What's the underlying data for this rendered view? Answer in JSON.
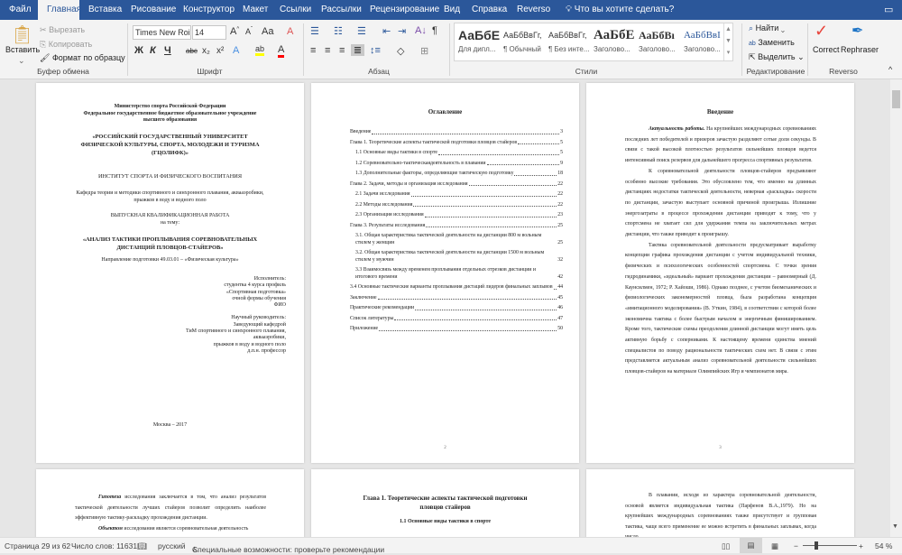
{
  "tabs": [
    "Файл",
    "Главная",
    "Вставка",
    "Рисование",
    "Конструктор",
    "Макет",
    "Ссылки",
    "Рассылки",
    "Рецензирование",
    "Вид",
    "Справка",
    "Reverso"
  ],
  "tell_me": "Что вы хотите сделать?",
  "clipboard": {
    "paste": "Вставить",
    "cut": "Вырезать",
    "copy": "Копировать",
    "format_painter": "Формат по образцу",
    "label": "Буфер обмена"
  },
  "font": {
    "name": "Times New Roi",
    "size": "14",
    "label": "Шрифт",
    "bold": "Ж",
    "italic": "К",
    "underline": "Ч"
  },
  "paragraph": {
    "label": "Абзац"
  },
  "styles": {
    "label": "Стили",
    "items": [
      {
        "preview": "АаБбЕ",
        "name": "Для дипл..."
      },
      {
        "preview": "АаБбВвГг,",
        "name": "¶ Обычный"
      },
      {
        "preview": "АаБбВвГг,",
        "name": "¶ Без инте..."
      },
      {
        "preview": "АаБбЕ",
        "name": "Заголово..."
      },
      {
        "preview": "АаБбВı",
        "name": "Заголово..."
      },
      {
        "preview": "АаБбВвI",
        "name": "Заголово..."
      }
    ]
  },
  "editing": {
    "find": "Найти",
    "replace": "Заменить",
    "select": "Выделить",
    "label": "Редактирование"
  },
  "reverso": {
    "correct": "Correct",
    "rephraser": "Rephraser",
    "label": "Reverso"
  },
  "colors": {
    "accent": "#2b579a",
    "highlight": "#ffff00",
    "font_color": "#ff0000"
  },
  "page1": {
    "lines_top": [
      "Министерство спорта Российской Федерации",
      "Федеральное государственное бюджетное образовательное учреждение",
      "высшего образования"
    ],
    "university": "«РОССИЙСКИЙ ГОСУДАРСТВЕННЫЙ УНИВЕРСИТЕТ ФИЗИЧЕСКОЙ КУЛЬТУРЫ, СПОРТА, МОЛОДЕЖИ И ТУРИЗМА (ГЦОЛИФК)»",
    "institute": "ИНСТИТУТ СПОРТА И ФИЗИЧЕСКОГО ВОСПИТАНИЯ",
    "department": "Кафедра теории и методики спортивного и синхронного плавания, аквааэробики, прыжков в воду и водного поло",
    "work_type": "ВЫПУСКНАЯ КВАЛИФИКАЦИОННАЯ РАБОТА",
    "on_topic": "на тему:",
    "title": "«АНАЛИЗ ТАКТИКИ ПРОПЛЫВАНИЯ СОРЕВНОВАТЕЛЬНЫХ ДИСТАНЦИЙ ПЛОВЦОВ-СТАЙЕРОВ»",
    "direction": "Направление подготовки 49.03.01 – «Физическая культура»",
    "executor": [
      "Исполнитель:",
      "студентка 4 курса профиль",
      "«Спортивная подготовка»",
      "очной формы обучения",
      "ФИО"
    ],
    "supervisor": [
      "Научный руководитель:",
      "Заведующий кафедрой",
      "ТиМ спортивного и синхронного плавания,",
      "аквааэробики,",
      "прыжков в воду и водного поло",
      "д.п.н. профессор"
    ],
    "city_year": "Москва – 2017"
  },
  "page2": {
    "heading": "Оглавление",
    "page_number": "2",
    "toc": [
      {
        "text": "Введение",
        "page": "3",
        "indent": false
      },
      {
        "text": "Глава 1. Теоретические аспекты тактической подготовки пловцов стайеров",
        "page": "5",
        "indent": false
      },
      {
        "text": "1.1 Основные виды тактики в спорте",
        "page": "5",
        "indent": true
      },
      {
        "text": "1.2 Соревновательно-тактическаядеятельность в плавании",
        "page": "9",
        "indent": true
      },
      {
        "text": "1.3 Дополнительные факторы, определяющие тактическую подготовку",
        "page": "18",
        "indent": true
      },
      {
        "text": "Глава 2. Задачи, методы и организация исследования",
        "page": "22",
        "indent": false
      },
      {
        "text": "2.1 Задачи исследования",
        "page": "22",
        "indent": true
      },
      {
        "text": "2.2 Методы исследования",
        "page": "22",
        "indent": true
      },
      {
        "text": "2.3 Организация исследования",
        "page": "23",
        "indent": true
      },
      {
        "text": "Глава 3. Результаты исследования",
        "page": "25",
        "indent": false
      },
      {
        "text": "3.1. Общая характеристика тактической деятельности на дистанции 800 м вольным стилем у женщин",
        "page": "25",
        "indent": true
      },
      {
        "text": "3.2. Общая характеристика тактической деятельности на дистанции 1500 м вольным стилем у мужчин",
        "page": "32",
        "indent": true
      },
      {
        "text": "3.3  Взаимосвязь между временем проплывания отдельных отрезков дистанции и итогового времени",
        "page": "42",
        "indent": true
      },
      {
        "text": "3.4     Основные тактические варианты проплывания дистаций лидеров финальных заплывов",
        "page": "44",
        "indent": false
      },
      {
        "text": "Заключение",
        "page": "45",
        "indent": false
      },
      {
        "text": "Практические рекомендации",
        "page": "46",
        "indent": false
      },
      {
        "text": "Список литературы",
        "page": "47",
        "indent": false
      },
      {
        "text": "Приложение",
        "page": "50",
        "indent": false
      }
    ]
  },
  "page3": {
    "heading": "Введение",
    "page_number": "3",
    "p1_lead": "Актуальность работы.",
    "p1": " На крупнейших международных соревнованиях последних лет победителей и призеров зачастую разделяют сотые доли секунды. В связи с такой высокой плотностью результатов сильнейших пловцов ведется интенсивный поиск резервов для дальнейшего прогресса спортивных результатов.",
    "p2": "К соревновательной деятельности пловцов-стайеров предъявляют особенно высокие требования. Это обусловлено тем, что именно на длинных дистанциях недостатки тактической деятельности, неверная «раскладка» скорости по дистанции, зачастую выступает основной причиной проигрыша. Излишние энергозатраты в процессе прохождения дистанции приводят к тому, что у спортсмена не хватает сил для удержания темпа на заключительных метрах дистанции, что также приводит к проигрышу.",
    "p3": "Тактика соревновательной деятельности предусматривает выработку концепции графика прохождения дистанции с учетом индивидуальной техники, физических и психологических особенностей спортсмена. С точки зрения гидродинамики, «идеальный» вариант прохождения дистанции – равномерный (Д. Каунсилмен, 1972; Р. Хайоши, 1986). Однако позднее, с учетом биомеханических и физиологических закономерностей пловца, была разработана концепция «имитационного моделирования» (В. Уткин, 1984), в соответствии с которой более экономична тактика с более быстрым началом и энергичным финишированием. Кроме того, тактические схемы преодоления длинной дистанции могут иметь цель активную борьбу с соперниками. К настоящему времени единства мнений специалистов по поводу рациональности тактических схем нет. В связи с этим представляется актуальным анализ соревновательной деятельности сильнейших пловцов-стайеров на материале Олимпийских Игр и чемпионатов мира."
  },
  "page4": {
    "p1_lead": "Гипотеза",
    "p1": " исследования заключается в том, что анализ результатов тактической деятельности лучших стайеров позволит определить наиболее эффективную тактику-раскладку прохождения дистанции.",
    "p2_lead": "Объектом",
    "p2": " исследования является соревновательная деятельность"
  },
  "page5": {
    "heading": "Глава 1. Теоретические аспекты тактической подготовки пловцов стайеров",
    "subheading": "1.1 Основные виды тактики в спорте"
  },
  "page6": {
    "p1": "В плавании, исходя из характера соревновательной деятельности, основой является индивидуальная тактика (Парфенов В.А.,1979). Но на крупнейших международных соревнованиях также присутствует и групповая тактика, чаще всего применение ее можно встретить в финальных заплывах, когда число"
  },
  "status": {
    "page": "Страница 29 из 62",
    "words": "Число слов: 11631",
    "language": "русский",
    "accessibility": "Специальные возможности: проверьте рекомендации",
    "zoom": "54 %",
    "zoom_percent": 54
  }
}
